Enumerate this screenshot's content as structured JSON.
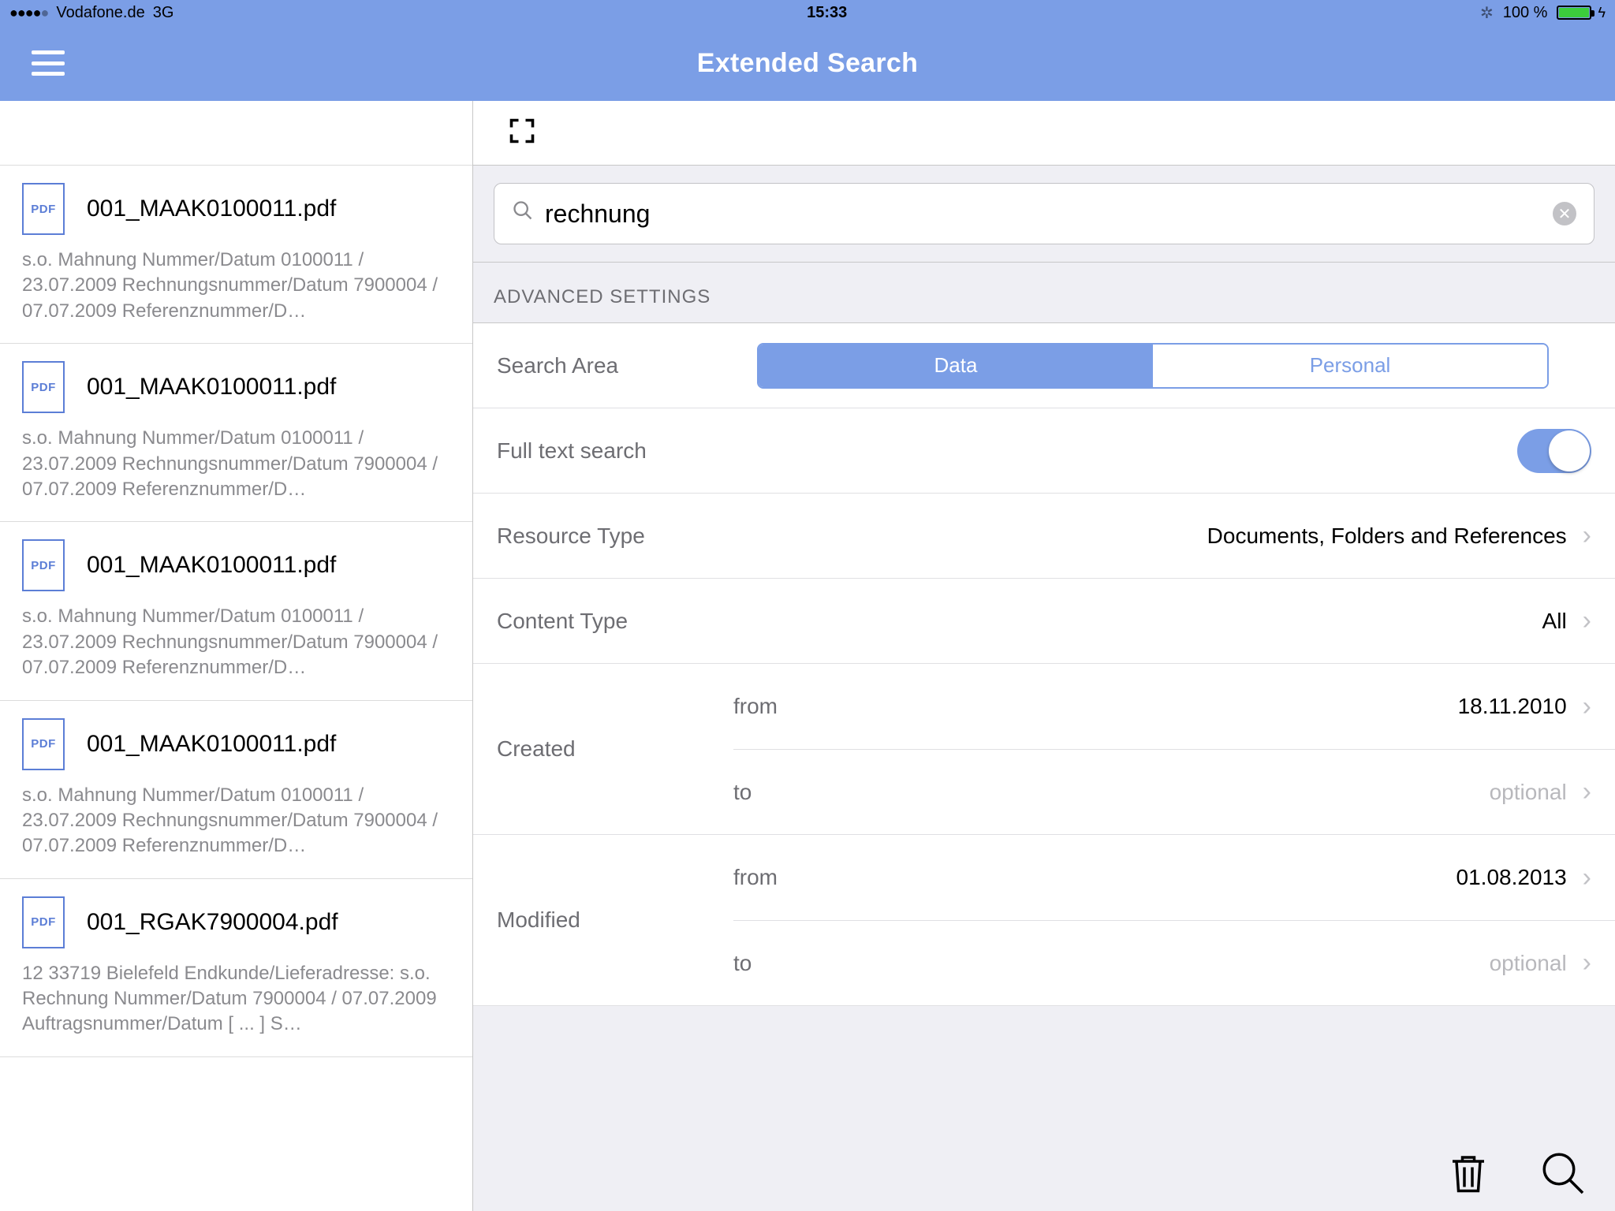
{
  "status_bar": {
    "carrier": "Vodafone.de",
    "network": "3G",
    "time": "15:33",
    "battery_pct": "100 %"
  },
  "nav": {
    "title": "Extended Search"
  },
  "results": [
    {
      "title": "001_MAAK0100011.pdf",
      "snippet": "s.o.  Mahnung  Nummer/Datum  0100011 / 23.07.2009  Rechnungsnummer/Datum 7900004 / 07.07.2009  Referenznummer/D…"
    },
    {
      "title": "001_MAAK0100011.pdf",
      "snippet": "s.o.  Mahnung  Nummer/Datum  0100011 / 23.07.2009  Rechnungsnummer/Datum 7900004 / 07.07.2009  Referenznummer/D…"
    },
    {
      "title": "001_MAAK0100011.pdf",
      "snippet": "s.o.  Mahnung  Nummer/Datum  0100011 / 23.07.2009  Rechnungsnummer/Datum 7900004 / 07.07.2009  Referenznummer/D…"
    },
    {
      "title": "001_MAAK0100011.pdf",
      "snippet": "s.o.  Mahnung  Nummer/Datum  0100011 / 23.07.2009  Rechnungsnummer/Datum 7900004 / 07.07.2009  Referenznummer/D…"
    },
    {
      "title": "001_RGAK7900004.pdf",
      "snippet": "12  33719 Bielefeld  Endkunde/Lieferadresse: s.o.  Rechnung  Nummer/Datum  7900004 / 07.07.2009  Auftragsnummer/Datum [ ... ] S…"
    }
  ],
  "search": {
    "value": "rechnung"
  },
  "advanced": {
    "header": "ADVANCED SETTINGS",
    "search_area_label": "Search Area",
    "seg_data": "Data",
    "seg_personal": "Personal",
    "fulltext_label": "Full text search",
    "fulltext_on": true,
    "resource_type_label": "Resource Type",
    "resource_type_value": "Documents, Folders and References",
    "content_type_label": "Content Type",
    "content_type_value": "All",
    "created_label": "Created",
    "modified_label": "Modified",
    "from_label": "from",
    "to_label": "to",
    "created_from": "18.11.2010",
    "created_to": "optional",
    "modified_from": "01.08.2013",
    "modified_to": "optional"
  },
  "icons": {
    "pdf": "PDF"
  }
}
